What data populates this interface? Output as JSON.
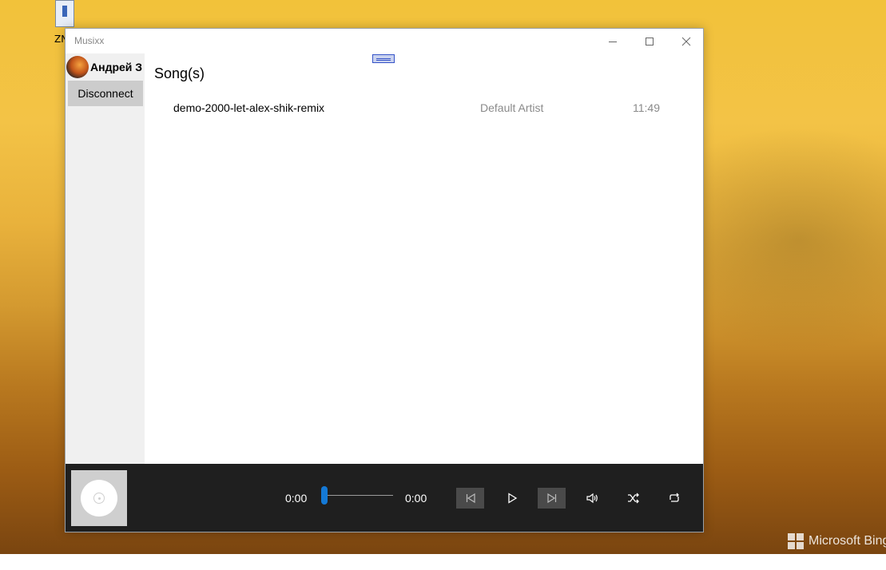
{
  "desktop": {
    "icon_label": "ZN",
    "watermark": "Microsoft Bing"
  },
  "window": {
    "title": "Musixx",
    "controls": {
      "minimize_icon": "minimize-icon",
      "maximize_icon": "maximize-icon",
      "close_icon": "close-icon"
    }
  },
  "sidebar": {
    "user_name": "Андрей З",
    "disconnect_label": "Disconnect"
  },
  "main": {
    "heading": "Song(s)",
    "songs": [
      {
        "title": "demo-2000-let-alex-shik-remix",
        "artist": "Default Artist",
        "duration": "11:49"
      }
    ]
  },
  "player": {
    "current_time": "0:00",
    "total_time": "0:00",
    "progress": 0,
    "icons": [
      "previous-icon",
      "play-icon",
      "next-icon",
      "volume-icon",
      "shuffle-icon",
      "repeat-icon"
    ]
  },
  "colors": {
    "accent": "#1479d6",
    "player_bg": "#1f1f1f",
    "sidebar_bg": "#f0f0f0",
    "disabled_button_bg": "#4a4a4a"
  }
}
